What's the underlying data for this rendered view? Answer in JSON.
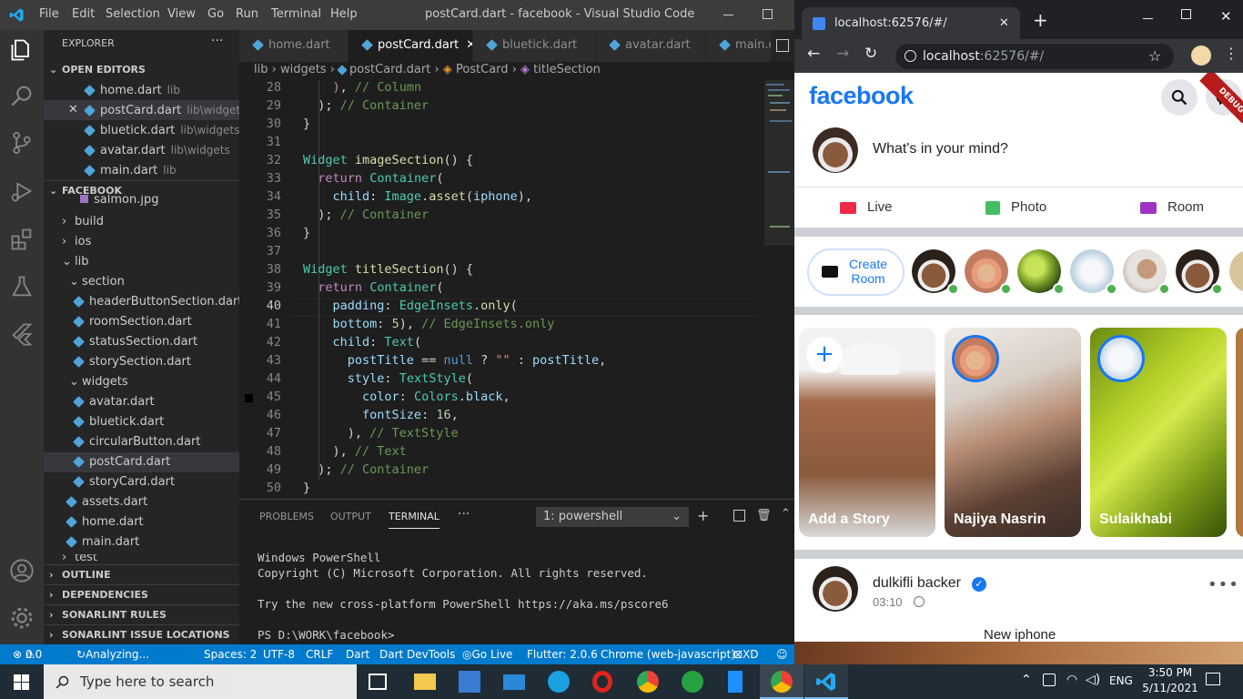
{
  "vscode": {
    "menu": [
      "File",
      "Edit",
      "Selection",
      "View",
      "Go",
      "Run",
      "Terminal",
      "Help"
    ],
    "window_title": "postCard.dart - facebook - Visual Studio Code",
    "explorer_title": "EXPLORER",
    "open_editors_title": "OPEN EDITORS",
    "open_editors": [
      {
        "name": "home.dart",
        "path": "lib"
      },
      {
        "name": "postCard.dart",
        "path": "lib\\widgets"
      },
      {
        "name": "bluetick.dart",
        "path": "lib\\widgets"
      },
      {
        "name": "avatar.dart",
        "path": "lib\\widgets"
      },
      {
        "name": "main.dart",
        "path": "lib"
      }
    ],
    "project_title": "FACEBOOK",
    "tree": {
      "salmon": "salmon.jpg",
      "build": "build",
      "ios": "ios",
      "lib": "lib",
      "section": "section",
      "section_files": [
        "headerButtonSection.dart",
        "roomSection.dart",
        "statusSection.dart",
        "storySection.dart"
      ],
      "widgets": "widgets",
      "widget_files": [
        "avatar.dart",
        "bluetick.dart",
        "circularButton.dart",
        "postCard.dart",
        "storyCard.dart"
      ],
      "lib_files": [
        "assets.dart",
        "home.dart",
        "main.dart"
      ],
      "test": "test"
    },
    "bottom_sections": [
      "OUTLINE",
      "DEPENDENCIES",
      "SONARLINT RULES",
      "SONARLINT ISSUE LOCATIONS"
    ],
    "tabs": [
      "home.dart",
      "postCard.dart",
      "bluetick.dart",
      "avatar.dart",
      "main.da"
    ],
    "breadcrumb": [
      "lib",
      "widgets",
      "postCard.dart",
      "PostCard",
      "titleSection"
    ],
    "line_numbers": [
      "28",
      "29",
      "30",
      "31",
      "32",
      "33",
      "34",
      "35",
      "36",
      "37",
      "38",
      "39",
      "40",
      "41",
      "42",
      "43",
      "44",
      "45",
      "46",
      "47",
      "48",
      "49",
      "50"
    ],
    "panel_tabs": [
      "PROBLEMS",
      "OUTPUT",
      "TERMINAL"
    ],
    "terminal_select": "1: powershell",
    "terminal_lines": [
      "Windows PowerShell",
      "Copyright (C) Microsoft Corporation. All rights reserved.",
      "",
      "Try the new cross-platform PowerShell https://aka.ms/pscore6",
      "",
      "PS D:\\WORK\\facebook>"
    ],
    "status": {
      "errors": "0",
      "warnings": "0",
      "analyzing": "Analyzing...",
      "spaces": "Spaces: 2",
      "encoding": "UTF-8",
      "eol": "CRLF",
      "lang": "Dart",
      "devtools": "Dart DevTools",
      "golive": "Go Live",
      "flutter": "Flutter: 2.0.6",
      "device": "Chrome (web-javascript)",
      "xd": "XD"
    }
  },
  "browser": {
    "tab_title": "localhost:62576/#/",
    "url_host": "localhost",
    "url_rest": ":62576/#/",
    "debug_banner": "DEBUG"
  },
  "facebook": {
    "logo": "facebook",
    "composer_placeholder": "What's in your mind?",
    "actions": [
      "Live",
      "Photo",
      "Room"
    ],
    "create_room": [
      "Create",
      "Room"
    ],
    "stories": [
      "Add a Story",
      "Najiya Nasrin",
      "Sulaikhabi"
    ],
    "post_author": "dulkifli backer",
    "post_time": "03:10",
    "post_title": "New iphone"
  },
  "taskbar": {
    "search_placeholder": "Type here to search",
    "lang": "ENG",
    "time": "3:50 PM",
    "date": "5/11/2021"
  },
  "colors": {
    "accent": "#007acc",
    "facebook_blue": "#1877f2",
    "live_red": "#f02849",
    "photo_green": "#45bd62",
    "room_purple": "#a033c4"
  }
}
